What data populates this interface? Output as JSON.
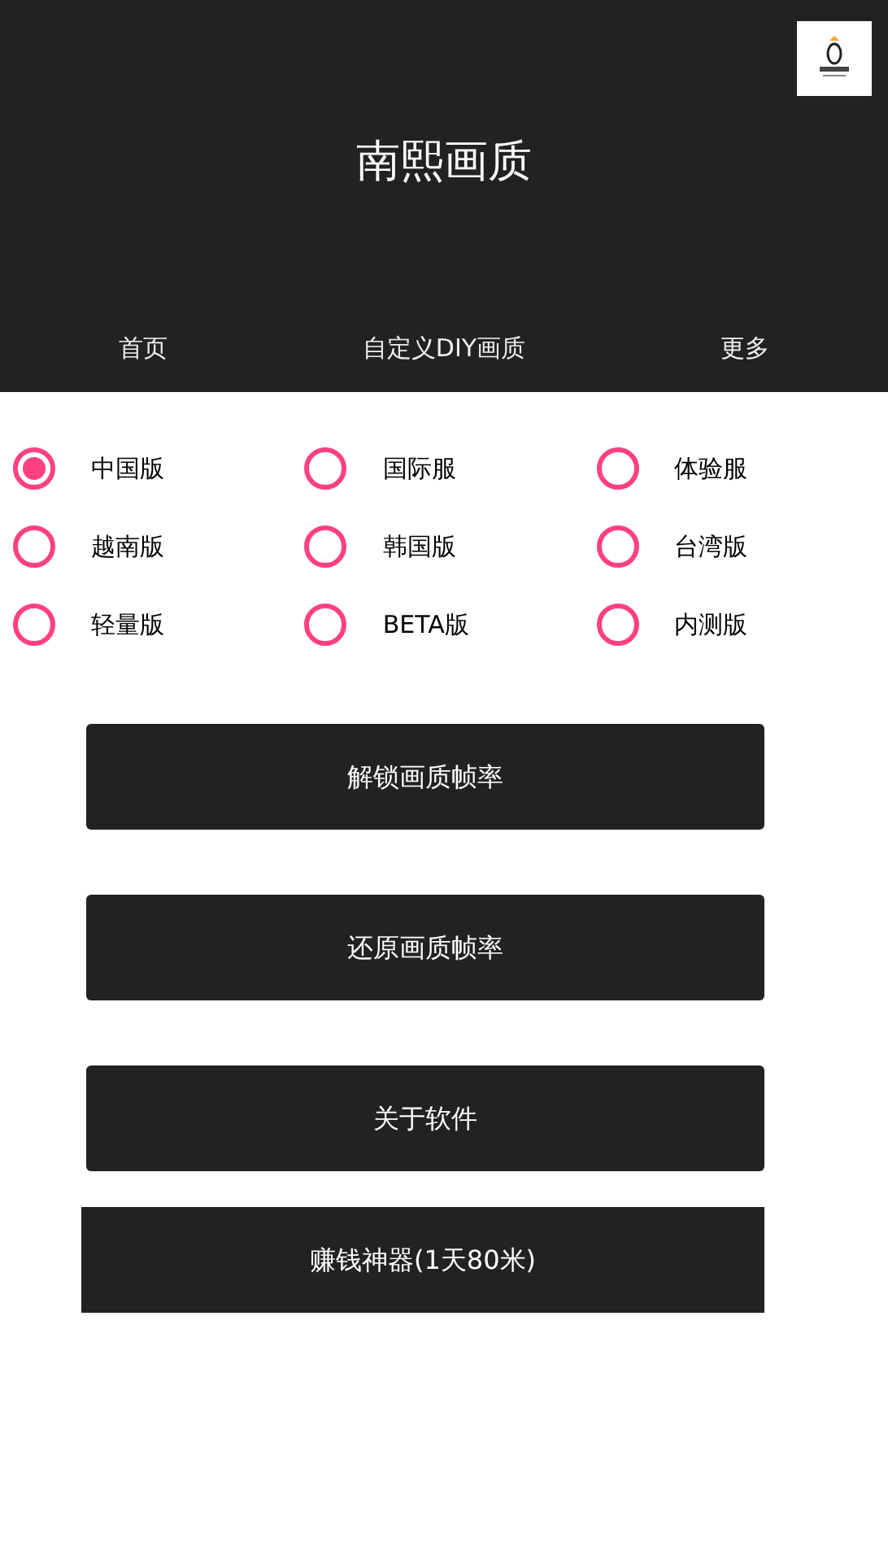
{
  "header": {
    "title": "南熙画质"
  },
  "tabs": [
    {
      "label": "首页"
    },
    {
      "label": "自定义DIY画质"
    },
    {
      "label": "更多"
    }
  ],
  "versions": [
    {
      "label": "中国版",
      "selected": true
    },
    {
      "label": "国际服",
      "selected": false
    },
    {
      "label": "体验服",
      "selected": false
    },
    {
      "label": "越南版",
      "selected": false
    },
    {
      "label": "韩国版",
      "selected": false
    },
    {
      "label": "台湾版",
      "selected": false
    },
    {
      "label": "轻量版",
      "selected": false
    },
    {
      "label": "BETA版",
      "selected": false
    },
    {
      "label": "内测版",
      "selected": false
    }
  ],
  "buttons": [
    {
      "label": "解锁画质帧率",
      "kind": "rounded"
    },
    {
      "label": "还原画质帧率",
      "kind": "rounded"
    },
    {
      "label": "关于软件",
      "kind": "rounded"
    },
    {
      "label": "赚钱神器(1天80米)",
      "kind": "square"
    }
  ]
}
